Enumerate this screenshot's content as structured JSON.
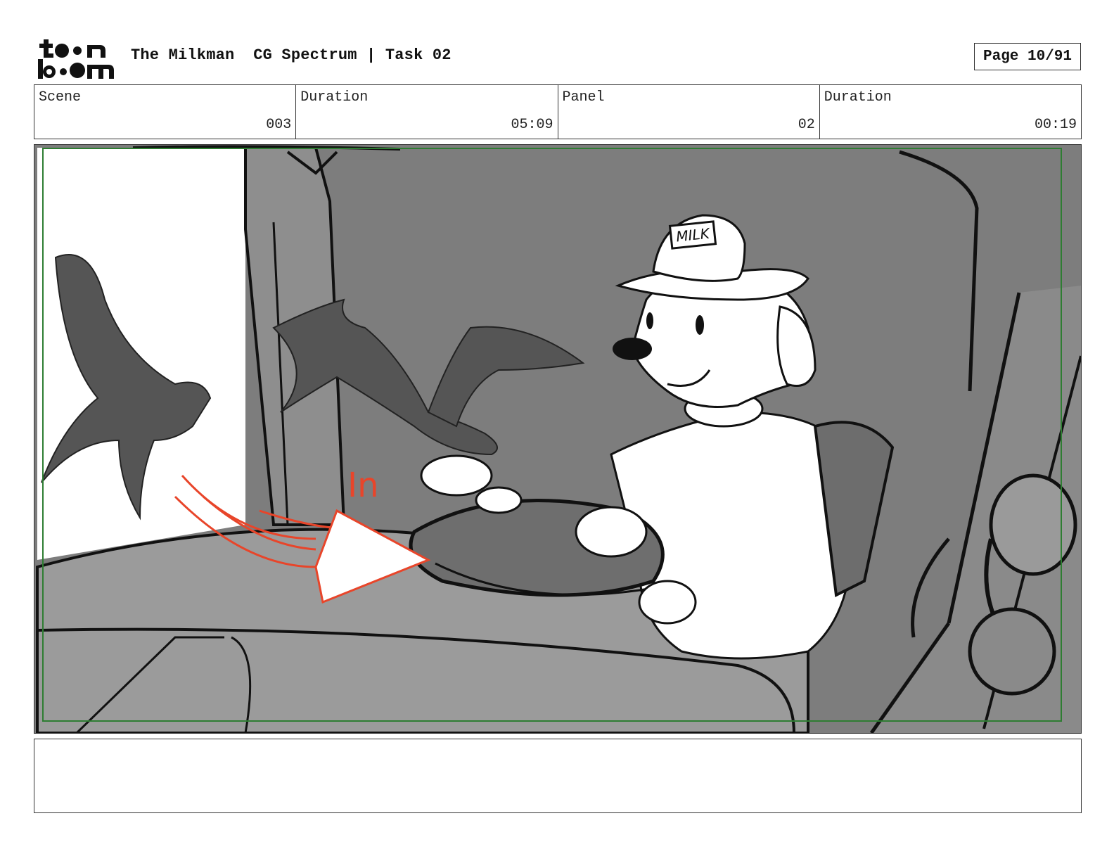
{
  "header": {
    "logo_text": "toon boom",
    "project_title": "The Milkman  CG Spectrum | Task 02",
    "page_label": "Page 10/91"
  },
  "info": [
    {
      "label": "Scene",
      "value": "003"
    },
    {
      "label": "Duration",
      "value": "05:09"
    },
    {
      "label": "Panel",
      "value": "02"
    },
    {
      "label": "Duration",
      "value": "00:19"
    }
  ],
  "panel": {
    "cap_text": "MILK",
    "annotation": "In",
    "colors": {
      "safe_frame": "#2e7d32",
      "annotation": "#e8452a",
      "background_gray": "#7a7a7a"
    }
  },
  "notes": {
    "text": ""
  }
}
